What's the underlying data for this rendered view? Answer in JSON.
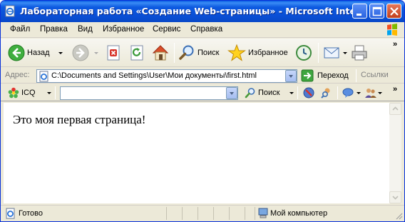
{
  "window": {
    "title": "Лабораторная работа «Создание Web-страницы» - Microsoft Internet E..."
  },
  "menu": {
    "items": [
      "Файл",
      "Правка",
      "Вид",
      "Избранное",
      "Сервис",
      "Справка"
    ]
  },
  "toolbar": {
    "back_label": "Назад",
    "search_label": "Поиск",
    "favorites_label": "Избранное"
  },
  "address": {
    "label": "Адрес:",
    "value": "C:\\Documents and Settings\\User\\Мои документы\\first.html",
    "go_label": "Переход",
    "links_label": "Ссылки"
  },
  "icq_toolbar": {
    "icq_label": "ICQ",
    "search_value": "",
    "search_label": "Поиск"
  },
  "page": {
    "text": "Это моя первая страница!"
  },
  "status": {
    "left_text": "Готово",
    "zone_text": "Мой компьютер"
  },
  "icons": [
    "ie-page-icon",
    "minimize-icon",
    "maximize-icon",
    "close-icon",
    "windows-logo-icon",
    "back-arrow-icon",
    "forward-arrow-icon",
    "stop-icon",
    "refresh-icon",
    "home-icon",
    "search-magnifier-icon",
    "favorites-star-icon",
    "history-icon",
    "mail-icon",
    "print-icon",
    "go-arrow-icon",
    "icq-flower-icon",
    "search-small-icon",
    "popup-blocker-icon",
    "messenger-icon",
    "contacts-icon",
    "computer-icon"
  ]
}
